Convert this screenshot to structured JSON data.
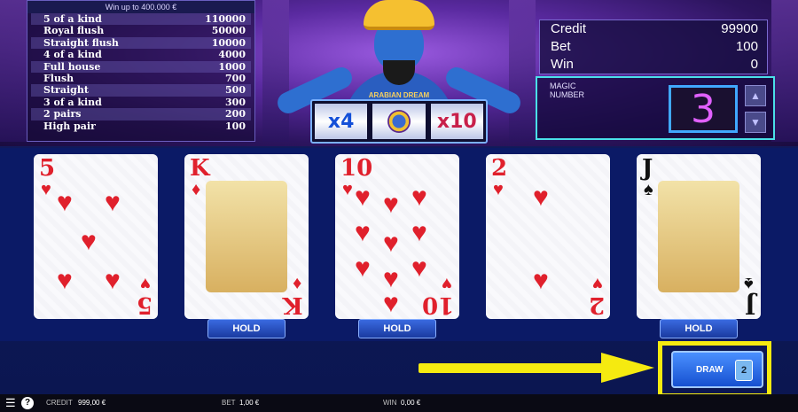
{
  "paytable": {
    "header": "Win up to 400.000 €",
    "rows": [
      {
        "hand": "5 of a kind",
        "pay": "110000"
      },
      {
        "hand": "Royal flush",
        "pay": "50000"
      },
      {
        "hand": "Straight flush",
        "pay": "10000"
      },
      {
        "hand": "4 of a kind",
        "pay": "4000"
      },
      {
        "hand": "Full house",
        "pay": "1000"
      },
      {
        "hand": "Flush",
        "pay": "700"
      },
      {
        "hand": "Straight",
        "pay": "500"
      },
      {
        "hand": "3 of a kind",
        "pay": "300"
      },
      {
        "hand": "2 pairs",
        "pay": "200"
      },
      {
        "hand": "High pair",
        "pay": "100"
      }
    ]
  },
  "logo": "ARABIAN DREAM",
  "multipliers": {
    "left": "x4",
    "right": "x10",
    "center_icon": "genie-emblem-icon"
  },
  "info": {
    "credit_label": "Credit",
    "credit_value": "99900",
    "bet_label": "Bet",
    "bet_value": "100",
    "win_label": "Win",
    "win_value": "0"
  },
  "magic": {
    "label": "MAGIC NUMBER",
    "value": "3"
  },
  "cards": [
    {
      "rank": "5",
      "suit": "♥",
      "color": "#e0202c",
      "held": false,
      "hold_label": ""
    },
    {
      "rank": "K",
      "suit": "♦",
      "color": "#e0202c",
      "held": true,
      "hold_label": "HOLD"
    },
    {
      "rank": "10",
      "suit": "♥",
      "color": "#e0202c",
      "held": true,
      "hold_label": "HOLD"
    },
    {
      "rank": "2",
      "suit": "♥",
      "color": "#e0202c",
      "held": false,
      "hold_label": ""
    },
    {
      "rank": "J",
      "suit": "♠",
      "color": "#111111",
      "held": true,
      "hold_label": "HOLD"
    }
  ],
  "draw": {
    "label": "DRAW",
    "icon_text": "2"
  },
  "bottom_bar": {
    "credit_label": "CREDIT",
    "credit_value": "999,00 €",
    "bet_label": "BET",
    "bet_value": "1,00 €",
    "win_label": "WIN",
    "win_value": "0,00 €"
  },
  "colors": {
    "highlight": "#f5ea10",
    "hold_button": "#1a3aa0",
    "magic_border": "#4ae0e8"
  }
}
